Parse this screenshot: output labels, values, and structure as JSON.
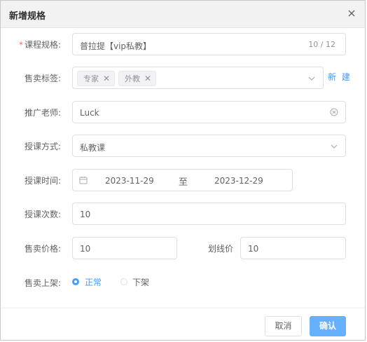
{
  "dialog": {
    "title": "新增规格"
  },
  "form": {
    "spec": {
      "label": "课程规格:",
      "value": "普拉提【vip私教】",
      "counter": "10 / 12"
    },
    "tags": {
      "label": "售卖标签:",
      "items": [
        "专家",
        "外教"
      ],
      "new_link": "新 建"
    },
    "teacher": {
      "label": "推广老师:",
      "value": "Luck"
    },
    "method": {
      "label": "授课方式:",
      "value": "私教课"
    },
    "time": {
      "label": "授课时间:",
      "start": "2023-11-29",
      "separator": "至",
      "end": "2023-12-29"
    },
    "count": {
      "label": "授课次数:",
      "value": "10"
    },
    "price": {
      "label": "售卖价格:",
      "value": "10"
    },
    "strike_price": {
      "label": "划线价",
      "value": "10"
    },
    "shelf": {
      "label": "售卖上架:",
      "options": [
        "正常",
        "下架"
      ],
      "selected": "正常"
    }
  },
  "footer": {
    "cancel": "取消",
    "confirm": "确认"
  },
  "colors": {
    "primary": "#409eff",
    "required": "#f56c6c",
    "confirm_bg": "#66b1ff"
  }
}
